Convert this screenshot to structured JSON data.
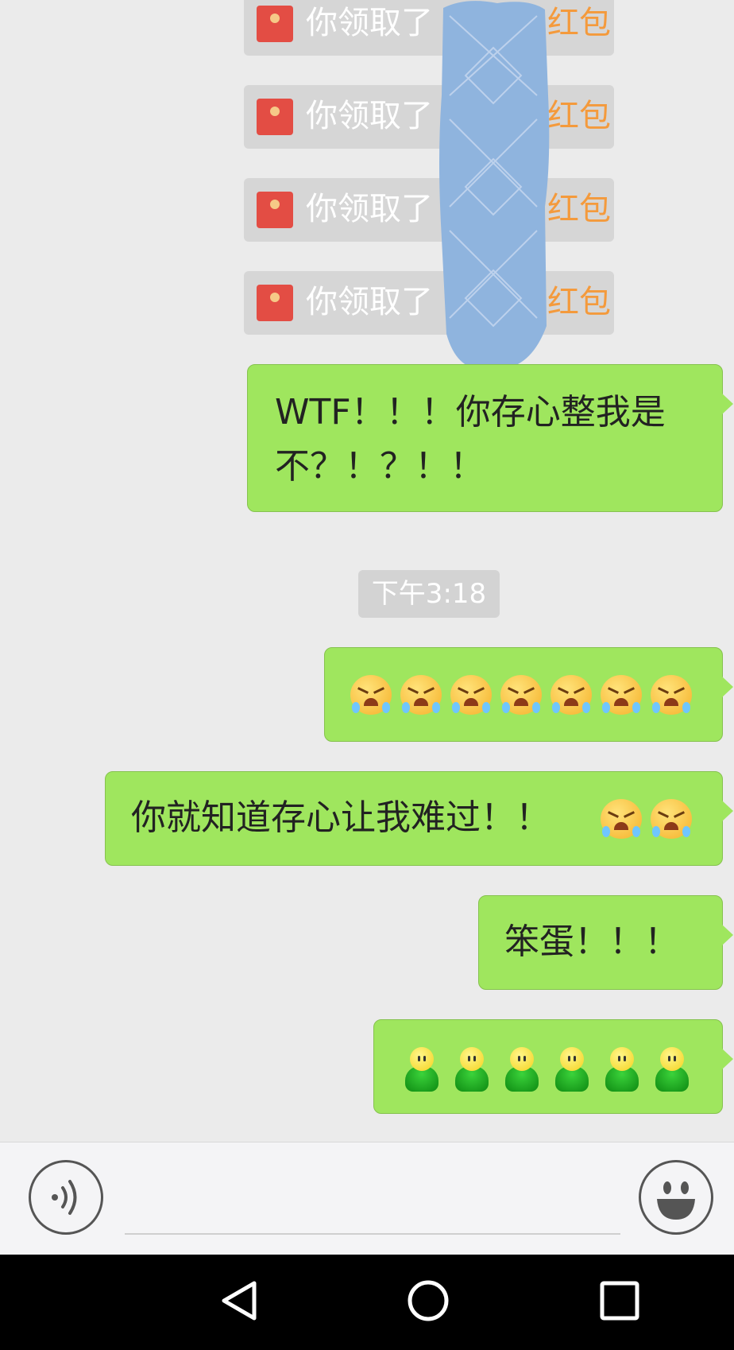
{
  "notices": [
    {
      "text": "你领取了",
      "link": "红包"
    },
    {
      "text": "你领取了",
      "link": "红包"
    },
    {
      "text": "你领取了",
      "link": "红包"
    },
    {
      "text": "你领取了",
      "link": "红包"
    }
  ],
  "messages": {
    "m1_line1": "WTF！！！你存心整我是",
    "m1_line2": "不？！？！！",
    "timestamp": "下午3:18",
    "m2_emoji_count": 7,
    "m3_text": "你就知道存心让我难过！！",
    "m3_emoji_count": 2,
    "m4_text": "笨蛋！！！",
    "m5_emoji_count": 6
  },
  "icons": {
    "voice": "voice-icon",
    "emoji": "smiley-icon",
    "red_packet": "red-packet-icon",
    "nav_back": "back-triangle-icon",
    "nav_home": "home-circle-icon",
    "nav_recent": "recent-square-icon"
  },
  "colors": {
    "chat_bg": "#ebebeb",
    "bubble_green": "#9fe65e",
    "notice_bg": "#d6d6d6",
    "link_orange": "#f49a3c",
    "red_packet": "#e34d44",
    "redaction_blue": "#8fb4de"
  }
}
